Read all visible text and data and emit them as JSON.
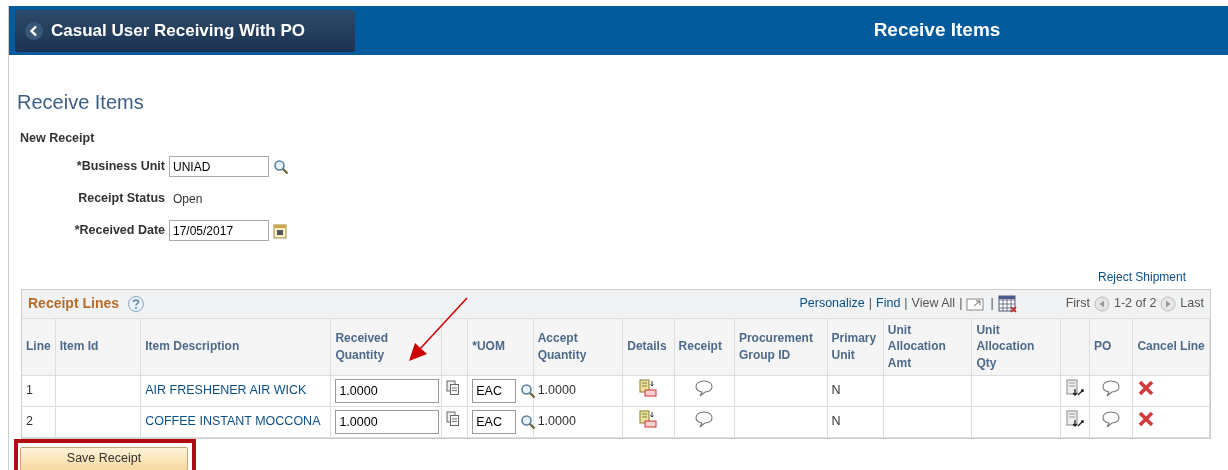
{
  "header": {
    "back_button": "Casual User Receiving With PO",
    "title": "Receive Items"
  },
  "page_title": "Receive Items",
  "section": "New Receipt",
  "fields": [
    {
      "kind": "lookup",
      "label": "*Business Unit",
      "value": "UNIAD"
    },
    {
      "kind": "text",
      "label": "Receipt Status",
      "value": "Open"
    },
    {
      "kind": "date",
      "label": "*Received Date",
      "value": "17/05/2017"
    }
  ],
  "reject_link": "Reject Shipment",
  "grid": {
    "title": "Receipt Lines",
    "toolbar": [
      {
        "kind": "link",
        "text": "Personalize"
      },
      {
        "kind": "sep",
        "text": "|"
      },
      {
        "kind": "link",
        "text": "Find"
      },
      {
        "kind": "sep",
        "text": "|"
      },
      {
        "kind": "text",
        "text": "View All"
      },
      {
        "kind": "sep",
        "text": "|"
      },
      {
        "kind": "zoom"
      },
      {
        "kind": "sep",
        "text": "|"
      },
      {
        "kind": "download"
      },
      {
        "kind": "gap"
      },
      {
        "kind": "text",
        "text": "First"
      },
      {
        "kind": "prev"
      },
      {
        "kind": "text",
        "text": "1-2 of 2"
      },
      {
        "kind": "next"
      },
      {
        "kind": "text",
        "text": "Last"
      }
    ],
    "columns": [
      "Line",
      "Item Id",
      "Item Description",
      "Received Quantity",
      "",
      "*UOM",
      "Accept Quantity",
      "Details",
      "Receipt",
      "Procurement Group ID",
      "Primary Unit",
      "Unit Allocation Amt",
      "Unit Allocation Qty",
      "",
      "PO",
      "Cancel Line"
    ],
    "rows": [
      {
        "line": "1",
        "description": "AIR FRESHENER AIR WICK",
        "received_quantity": "1.0000",
        "uom": "EAC",
        "accept_quantity": "1.0000",
        "primary_unit": "N"
      },
      {
        "line": "2",
        "description": "COFFEE INSTANT MOCCONA",
        "received_quantity": "1.0000",
        "uom": "EAC",
        "accept_quantity": "1.0000",
        "primary_unit": "N"
      }
    ]
  },
  "save_button": "Save Receipt"
}
